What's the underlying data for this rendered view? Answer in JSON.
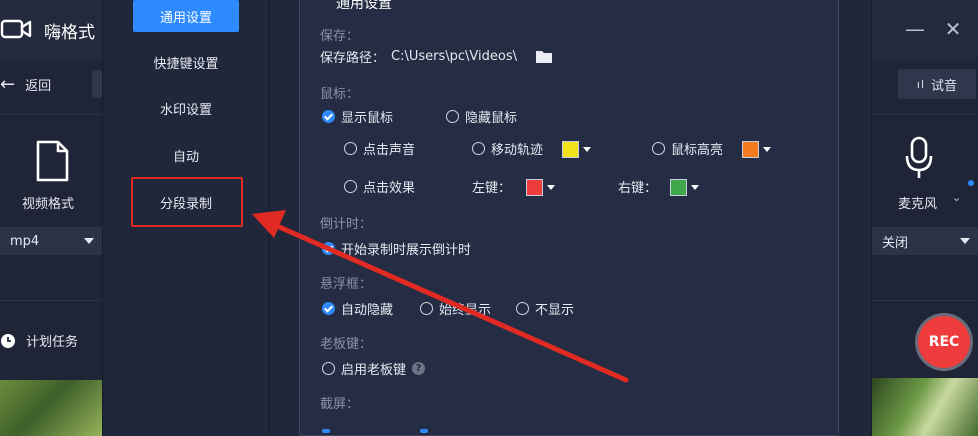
{
  "background_app": {
    "title": "嗨格式",
    "back_label": "返回",
    "audition_label": "试音",
    "audition_icon": "signal-bars-icon",
    "format_label": "视频格式",
    "format_value": "mp4",
    "mic_label": "麦克风",
    "mic_value": "关闭",
    "schedule_label": "计划任务",
    "rec_label": "REC",
    "minimize_glyph": "—",
    "close_glyph": "✕"
  },
  "settings_nav": {
    "items": [
      {
        "label": "通用设置",
        "active": true
      },
      {
        "label": "快捷键设置",
        "active": false
      },
      {
        "label": "水印设置",
        "active": false
      },
      {
        "label": "自动",
        "active": false
      },
      {
        "label": "分段录制",
        "active": false
      }
    ],
    "highlighted_item": "分段录制",
    "highlight_color": "#e12a22"
  },
  "general_settings": {
    "title": "通用设置",
    "save": {
      "header": "保存：",
      "path_label": "保存路径：",
      "path_value": "C:\\Users\\pc\\Videos\\"
    },
    "mouse": {
      "header": "鼠标：",
      "show_cursor": "显示鼠标",
      "hide_cursor": "隐藏鼠标",
      "show_cursor_checked": true,
      "click_sound": "点击声音",
      "move_trail": "移动轨迹",
      "move_trail_color": "#f2e21c",
      "cursor_highlight": "鼠标高亮",
      "cursor_highlight_color": "#f47a1f",
      "click_effect": "点击效果",
      "left_key_label": "左键：",
      "left_key_color": "#ee3b3b",
      "right_key_label": "右键：",
      "right_key_color": "#3fa64a"
    },
    "countdown": {
      "header": "倒计时：",
      "show_countdown": "开始录制时展示倒计时",
      "checked": true
    },
    "floating_box": {
      "header": "悬浮框：",
      "options": [
        "自动隐藏",
        "始终显示",
        "不显示"
      ],
      "selected": "自动隐藏"
    },
    "boss_key": {
      "header": "老板键：",
      "enable_label": "启用老板键",
      "enabled": false
    },
    "screenshot": {
      "header": "截屏："
    }
  },
  "colors": {
    "accent": "#2e8bff",
    "annotation": "#e12a22",
    "rec": "#ef3b3b"
  }
}
